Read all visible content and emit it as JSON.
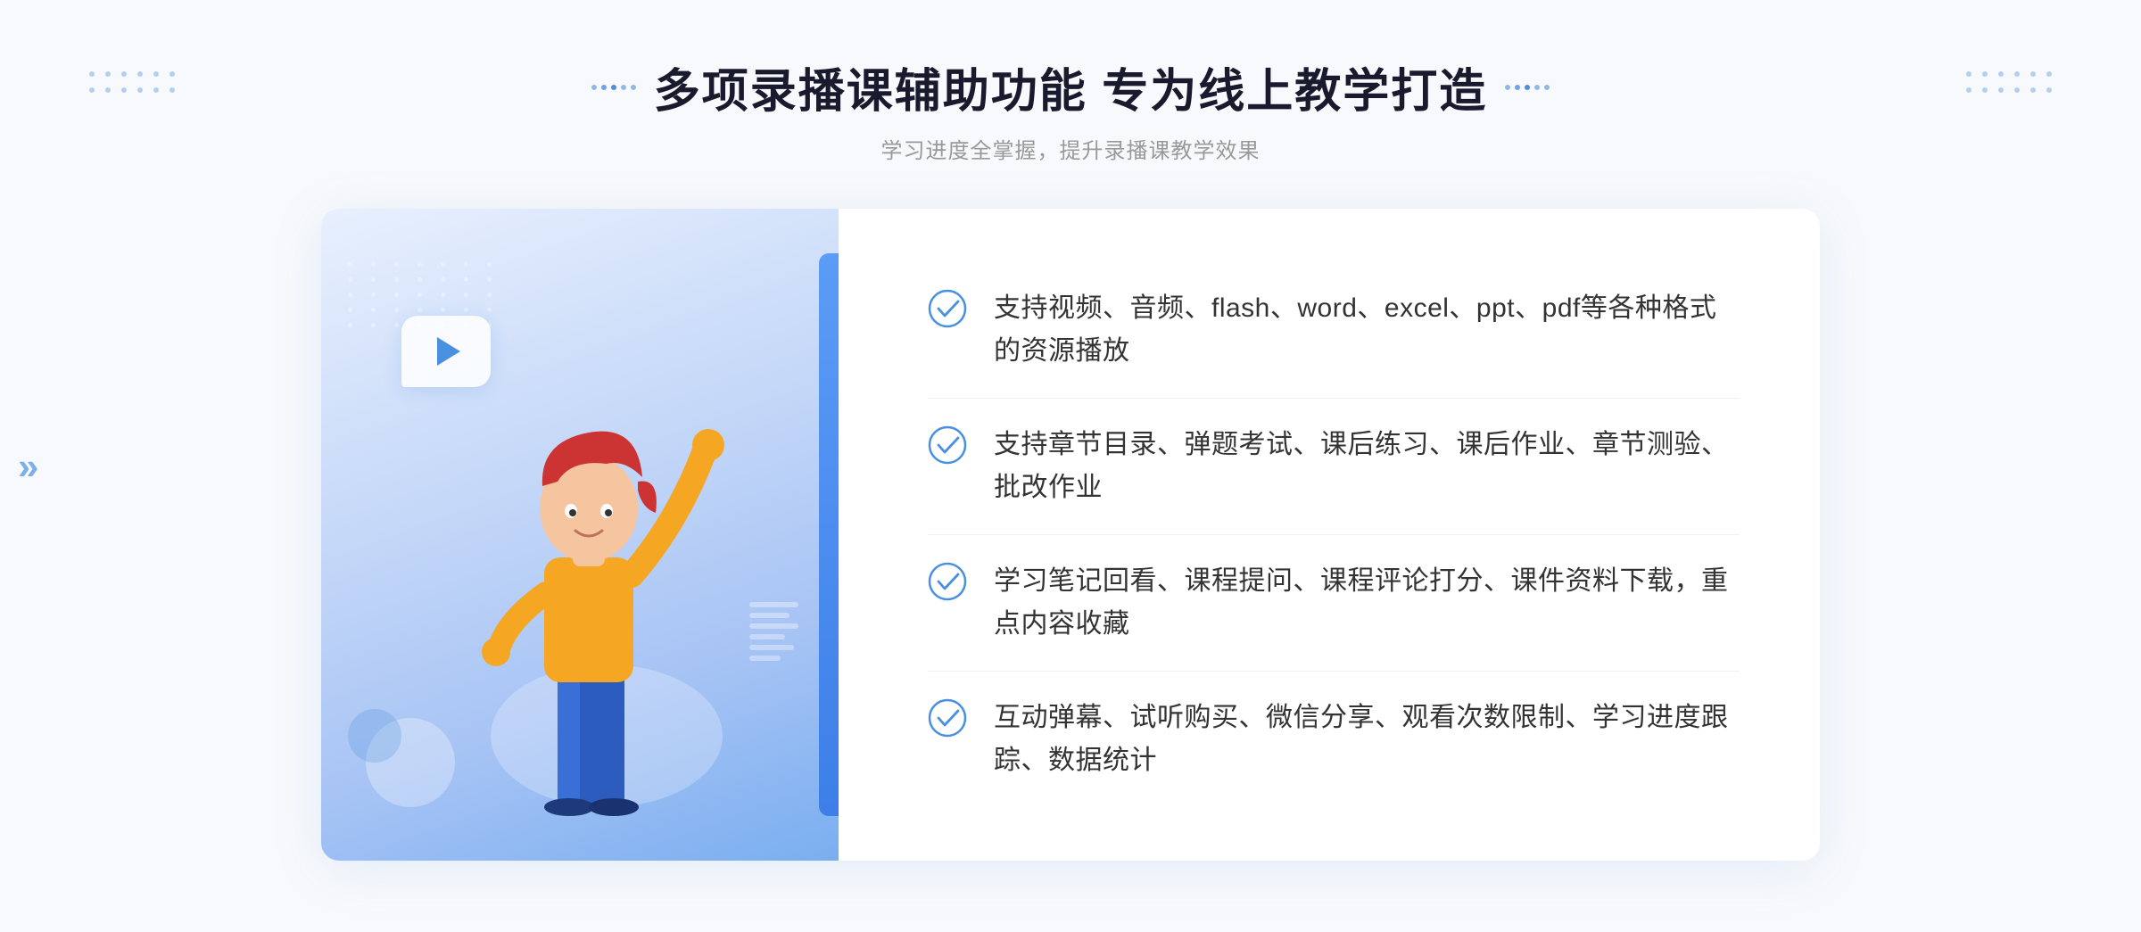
{
  "header": {
    "title": "多项录播课辅助功能 专为线上教学打造",
    "subtitle": "学习进度全掌握，提升录播课教学效果",
    "decorator_left_label": "decorator-dots-left",
    "decorator_right_label": "decorator-dots-right"
  },
  "features": [
    {
      "id": 1,
      "text": "支持视频、音频、flash、word、excel、ppt、pdf等各种格式的资源播放"
    },
    {
      "id": 2,
      "text": "支持章节目录、弹题考试、课后练习、课后作业、章节测验、批改作业"
    },
    {
      "id": 3,
      "text": "学习笔记回看、课程提问、课程评论打分、课件资料下载，重点内容收藏"
    },
    {
      "id": 4,
      "text": "互动弹幕、试听购买、微信分享、观看次数限制、学习进度跟踪、数据统计"
    }
  ],
  "colors": {
    "accent": "#4a90e2",
    "title": "#1a1a2e",
    "text": "#333333",
    "subtitle": "#999999",
    "check": "#4a90e2",
    "bg": "#f8f9fc"
  },
  "illustration": {
    "play_icon": "▶",
    "left_arrow": "«"
  }
}
